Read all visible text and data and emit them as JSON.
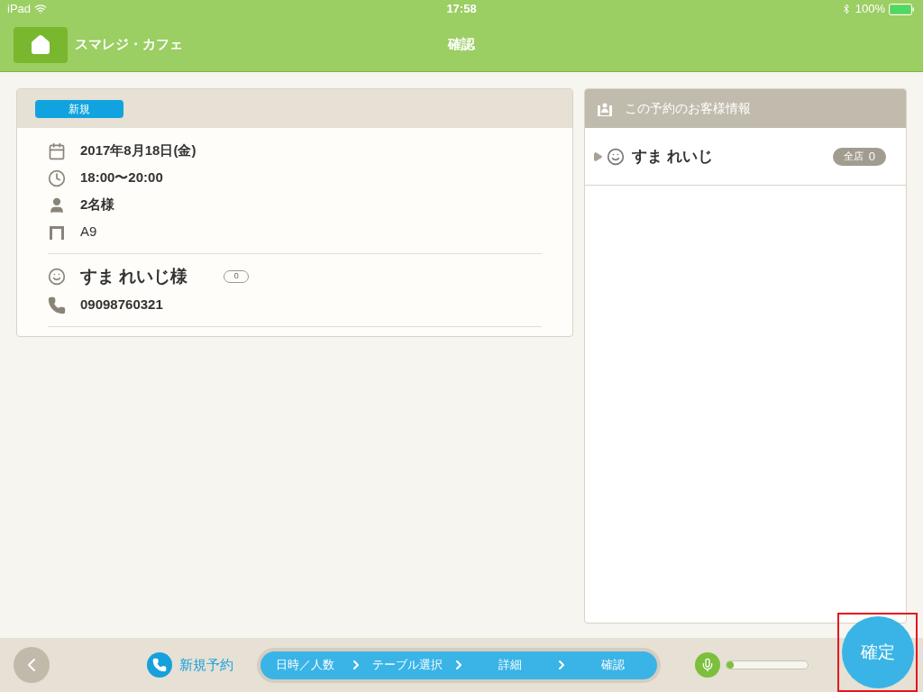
{
  "status_bar": {
    "device": "iPad",
    "time": "17:58",
    "battery": "100%"
  },
  "nav": {
    "shop": "スマレジ・カフェ",
    "title": "確認"
  },
  "reservation": {
    "badge": "新規",
    "details": [
      {
        "kind": "date",
        "text": "2017年8月18日(金)"
      },
      {
        "kind": "time",
        "text": "18:00〜20:00"
      },
      {
        "kind": "people",
        "text": "2名様"
      },
      {
        "kind": "table",
        "text": "A9"
      }
    ],
    "customer": {
      "name": "すま れいじ様",
      "visits": "0",
      "phone": "09098760321"
    }
  },
  "customer_panel": {
    "title": "この予約のお客様情報",
    "customers": [
      {
        "name": "すま れいじ",
        "expanded": false,
        "badge_label": "全店",
        "badge_count": "0"
      }
    ]
  },
  "footer": {
    "mode": "新規予約",
    "steps": [
      {
        "label": "日時／人数"
      },
      {
        "label": "テーブル選択"
      },
      {
        "label": "詳細"
      },
      {
        "label": "確認"
      }
    ],
    "mic": {
      "level": 0.05
    },
    "confirm": "確定",
    "confirm_highlighted": true
  }
}
